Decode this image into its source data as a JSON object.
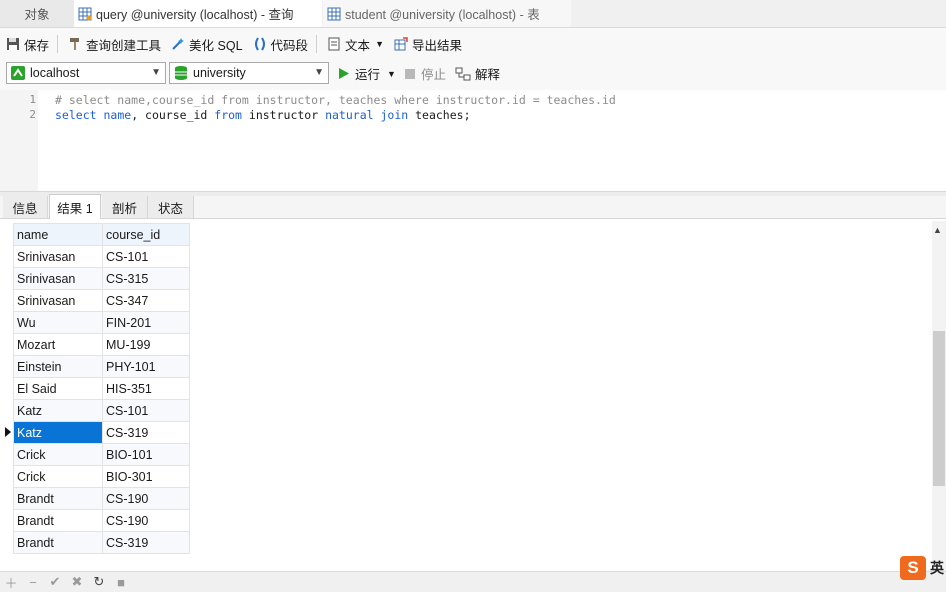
{
  "tabs": [
    {
      "label": "对象"
    },
    {
      "label": "query @university (localhost) - 查询"
    },
    {
      "label": "student @university (localhost) - 表"
    }
  ],
  "toolbar": {
    "save": "保存",
    "query_builder": "查询创建工具",
    "beautify": "美化 SQL",
    "snippet": "代码段",
    "text": "文本",
    "export": "导出结果"
  },
  "connection": {
    "server": "localhost",
    "database": "university",
    "run": "运行",
    "stop": "停止",
    "explain": "解释"
  },
  "editor": {
    "line_numbers": [
      "1",
      "2"
    ],
    "line1": "# select name,course_id from instructor, teaches where instructor.id = teaches.id",
    "line2_tokens": [
      "select",
      " ",
      "name",
      ", course_id ",
      "from",
      " instructor ",
      "natural",
      " ",
      "join",
      " teaches;"
    ]
  },
  "result_tabs": [
    "信息",
    "结果 1",
    "剖析",
    "状态"
  ],
  "results": {
    "columns": [
      "name",
      "course_id"
    ],
    "rows": [
      [
        "Srinivasan",
        "CS-101"
      ],
      [
        "Srinivasan",
        "CS-315"
      ],
      [
        "Srinivasan",
        "CS-347"
      ],
      [
        "Wu",
        "FIN-201"
      ],
      [
        "Mozart",
        "MU-199"
      ],
      [
        "Einstein",
        "PHY-101"
      ],
      [
        "El Said",
        "HIS-351"
      ],
      [
        "Katz",
        "CS-101"
      ],
      [
        "Katz",
        "CS-319"
      ],
      [
        "Crick",
        "BIO-101"
      ],
      [
        "Crick",
        "BIO-301"
      ],
      [
        "Brandt",
        "CS-190"
      ],
      [
        "Brandt",
        "CS-190"
      ],
      [
        "Brandt",
        "CS-319"
      ]
    ],
    "selected_row": 8
  },
  "statusbar": {
    "icons": [
      "plus-icon",
      "minus-icon",
      "check-icon",
      "cross-icon",
      "refresh-icon",
      "stop-icon"
    ],
    "ime_label": "英"
  },
  "colors": {
    "selection": "#0a73d6",
    "keyword": "#1d5fd1",
    "comment": "#8c8c8c",
    "run_green": "#2aa32a"
  }
}
